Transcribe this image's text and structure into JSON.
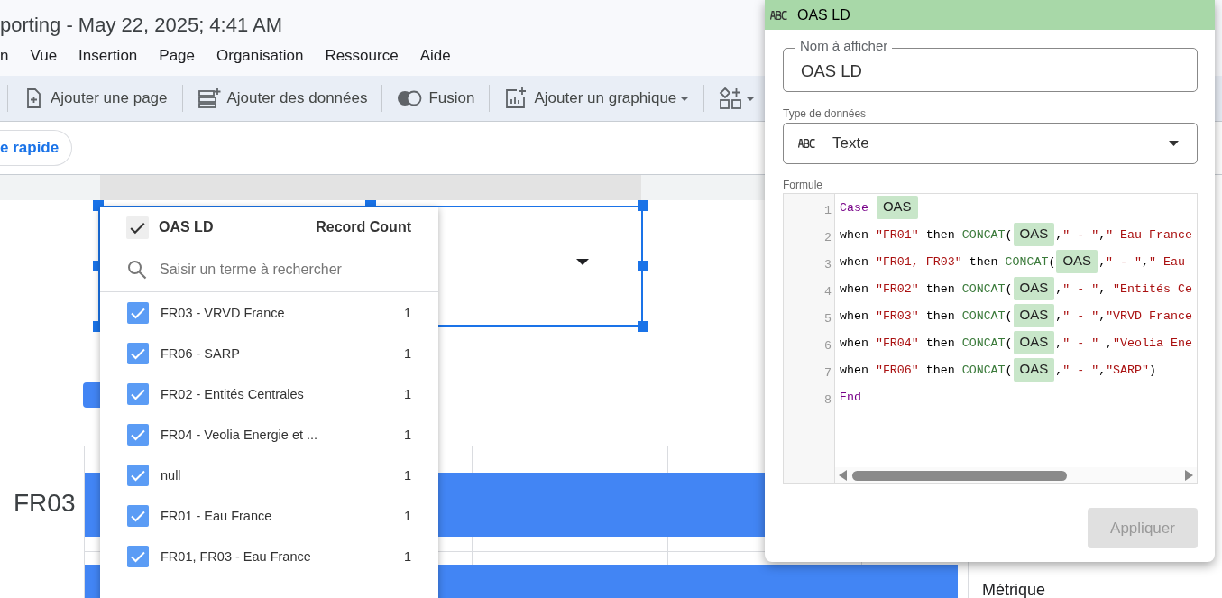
{
  "header": {
    "title": "porting - May 22, 2025; 4:41 AM",
    "menu": [
      "n",
      "Vue",
      "Insertion",
      "Page",
      "Organisation",
      "Ressource",
      "Aide"
    ]
  },
  "toolbar": [
    {
      "kind": "page",
      "label": "Ajouter une page",
      "dropdown": false
    },
    {
      "kind": "data",
      "label": "Ajouter des données",
      "dropdown": false
    },
    {
      "kind": "blend",
      "label": "Fusion",
      "dropdown": false
    },
    {
      "kind": "chart",
      "label": "Ajouter un graphique",
      "dropdown": true
    },
    {
      "kind": "controls",
      "dropdown": true
    }
  ],
  "filter_chip": "e rapide",
  "control": {
    "selected": true
  },
  "chart": {
    "bars": [
      {
        "kind": "labeled",
        "label": "FR03"
      },
      {
        "kind": "unlabeled"
      }
    ]
  },
  "dropdown": {
    "header": {
      "checked": true,
      "label": "OAS LD",
      "metric": "Record Count"
    },
    "search": {
      "placeholder": "Saisir un terme à rechercher"
    },
    "items": [
      {
        "label": "FR03 - VRVD France",
        "count": "1",
        "checked": true
      },
      {
        "label": "FR06 - SARP",
        "count": "1",
        "checked": true
      },
      {
        "label": "FR02 - Entités Centrales",
        "count": "1",
        "checked": true
      },
      {
        "label": "FR04 - Veolia Energie et ...",
        "count": "1",
        "checked": true
      },
      {
        "label": "null",
        "count": "1",
        "checked": true
      },
      {
        "label": "FR01 - Eau France",
        "count": "1",
        "checked": true
      },
      {
        "label": "FR01, FR03 - Eau France",
        "count": "1",
        "checked": true
      }
    ]
  },
  "dialog": {
    "title": "OAS LD",
    "name_field": {
      "label": "Nom à afficher",
      "value": "OAS LD"
    },
    "type_field": {
      "label": "Type de données",
      "value": "Texte"
    },
    "formula": {
      "label": "Formule",
      "lines": [
        {
          "number": "1",
          "tokens": [
            {
              "kind": "kw",
              "text": "Case"
            },
            {
              "kind": "field",
              "text": "OAS"
            }
          ]
        },
        {
          "number": "2",
          "tokens": [
            {
              "kind": "plain",
              "text": "when "
            },
            {
              "kind": "str",
              "text": "\"FR01\""
            },
            {
              "kind": "plain",
              "text": " then "
            },
            {
              "kind": "fn",
              "text": "CONCAT"
            },
            {
              "kind": "plain",
              "text": "("
            },
            {
              "kind": "field",
              "text": "OAS"
            },
            {
              "kind": "plain",
              "text": ","
            },
            {
              "kind": "str",
              "text": "\" - \""
            },
            {
              "kind": "plain",
              "text": ","
            },
            {
              "kind": "str",
              "text": "\" Eau France"
            }
          ]
        },
        {
          "number": "3",
          "tokens": [
            {
              "kind": "plain",
              "text": "when "
            },
            {
              "kind": "str",
              "text": "\"FR01, FR03\""
            },
            {
              "kind": "plain",
              "text": " then "
            },
            {
              "kind": "fn",
              "text": "CONCAT"
            },
            {
              "kind": "plain",
              "text": "("
            },
            {
              "kind": "field",
              "text": "OAS"
            },
            {
              "kind": "plain",
              "text": ","
            },
            {
              "kind": "str",
              "text": "\" - \""
            },
            {
              "kind": "plain",
              "text": ","
            },
            {
              "kind": "str",
              "text": "\" Eau"
            }
          ]
        },
        {
          "number": "4",
          "tokens": [
            {
              "kind": "plain",
              "text": "when "
            },
            {
              "kind": "str",
              "text": "\"FR02\""
            },
            {
              "kind": "plain",
              "text": " then "
            },
            {
              "kind": "fn",
              "text": "CONCAT"
            },
            {
              "kind": "plain",
              "text": "("
            },
            {
              "kind": "field",
              "text": "OAS"
            },
            {
              "kind": "plain",
              "text": ","
            },
            {
              "kind": "str",
              "text": "\" - \""
            },
            {
              "kind": "plain",
              "text": ", "
            },
            {
              "kind": "str",
              "text": "\"Entités Ce"
            }
          ]
        },
        {
          "number": "5",
          "tokens": [
            {
              "kind": "plain",
              "text": "when "
            },
            {
              "kind": "str",
              "text": "\"FR03\""
            },
            {
              "kind": "plain",
              "text": " then "
            },
            {
              "kind": "fn",
              "text": "CONCAT"
            },
            {
              "kind": "plain",
              "text": "("
            },
            {
              "kind": "field",
              "text": "OAS"
            },
            {
              "kind": "plain",
              "text": ","
            },
            {
              "kind": "str",
              "text": "\" - \""
            },
            {
              "kind": "plain",
              "text": ","
            },
            {
              "kind": "str",
              "text": "\"VRVD France"
            }
          ]
        },
        {
          "number": "6",
          "tokens": [
            {
              "kind": "plain",
              "text": "when "
            },
            {
              "kind": "str",
              "text": "\"FR04\""
            },
            {
              "kind": "plain",
              "text": " then "
            },
            {
              "kind": "fn",
              "text": "CONCAT"
            },
            {
              "kind": "plain",
              "text": "("
            },
            {
              "kind": "field",
              "text": "OAS"
            },
            {
              "kind": "plain",
              "text": ","
            },
            {
              "kind": "str",
              "text": "\" - \""
            },
            {
              "kind": "plain",
              "text": " ,"
            },
            {
              "kind": "str",
              "text": "\"Veolia Ene"
            }
          ]
        },
        {
          "number": "7",
          "tokens": [
            {
              "kind": "plain",
              "text": "when "
            },
            {
              "kind": "str",
              "text": "\"FR06\""
            },
            {
              "kind": "plain",
              "text": " then "
            },
            {
              "kind": "fn",
              "text": "CONCAT"
            },
            {
              "kind": "plain",
              "text": "("
            },
            {
              "kind": "field",
              "text": "OAS"
            },
            {
              "kind": "plain",
              "text": ","
            },
            {
              "kind": "str",
              "text": "\" - \""
            },
            {
              "kind": "plain",
              "text": ","
            },
            {
              "kind": "str",
              "text": "\"SARP\""
            },
            {
              "kind": "plain",
              "text": ")"
            }
          ]
        },
        {
          "number": "8",
          "tokens": [
            {
              "kind": "kw",
              "text": "End"
            }
          ]
        }
      ]
    },
    "apply_button": {
      "label": "Appliquer",
      "disabled": true
    }
  },
  "side_panel": {
    "heading": "Métrique"
  }
}
